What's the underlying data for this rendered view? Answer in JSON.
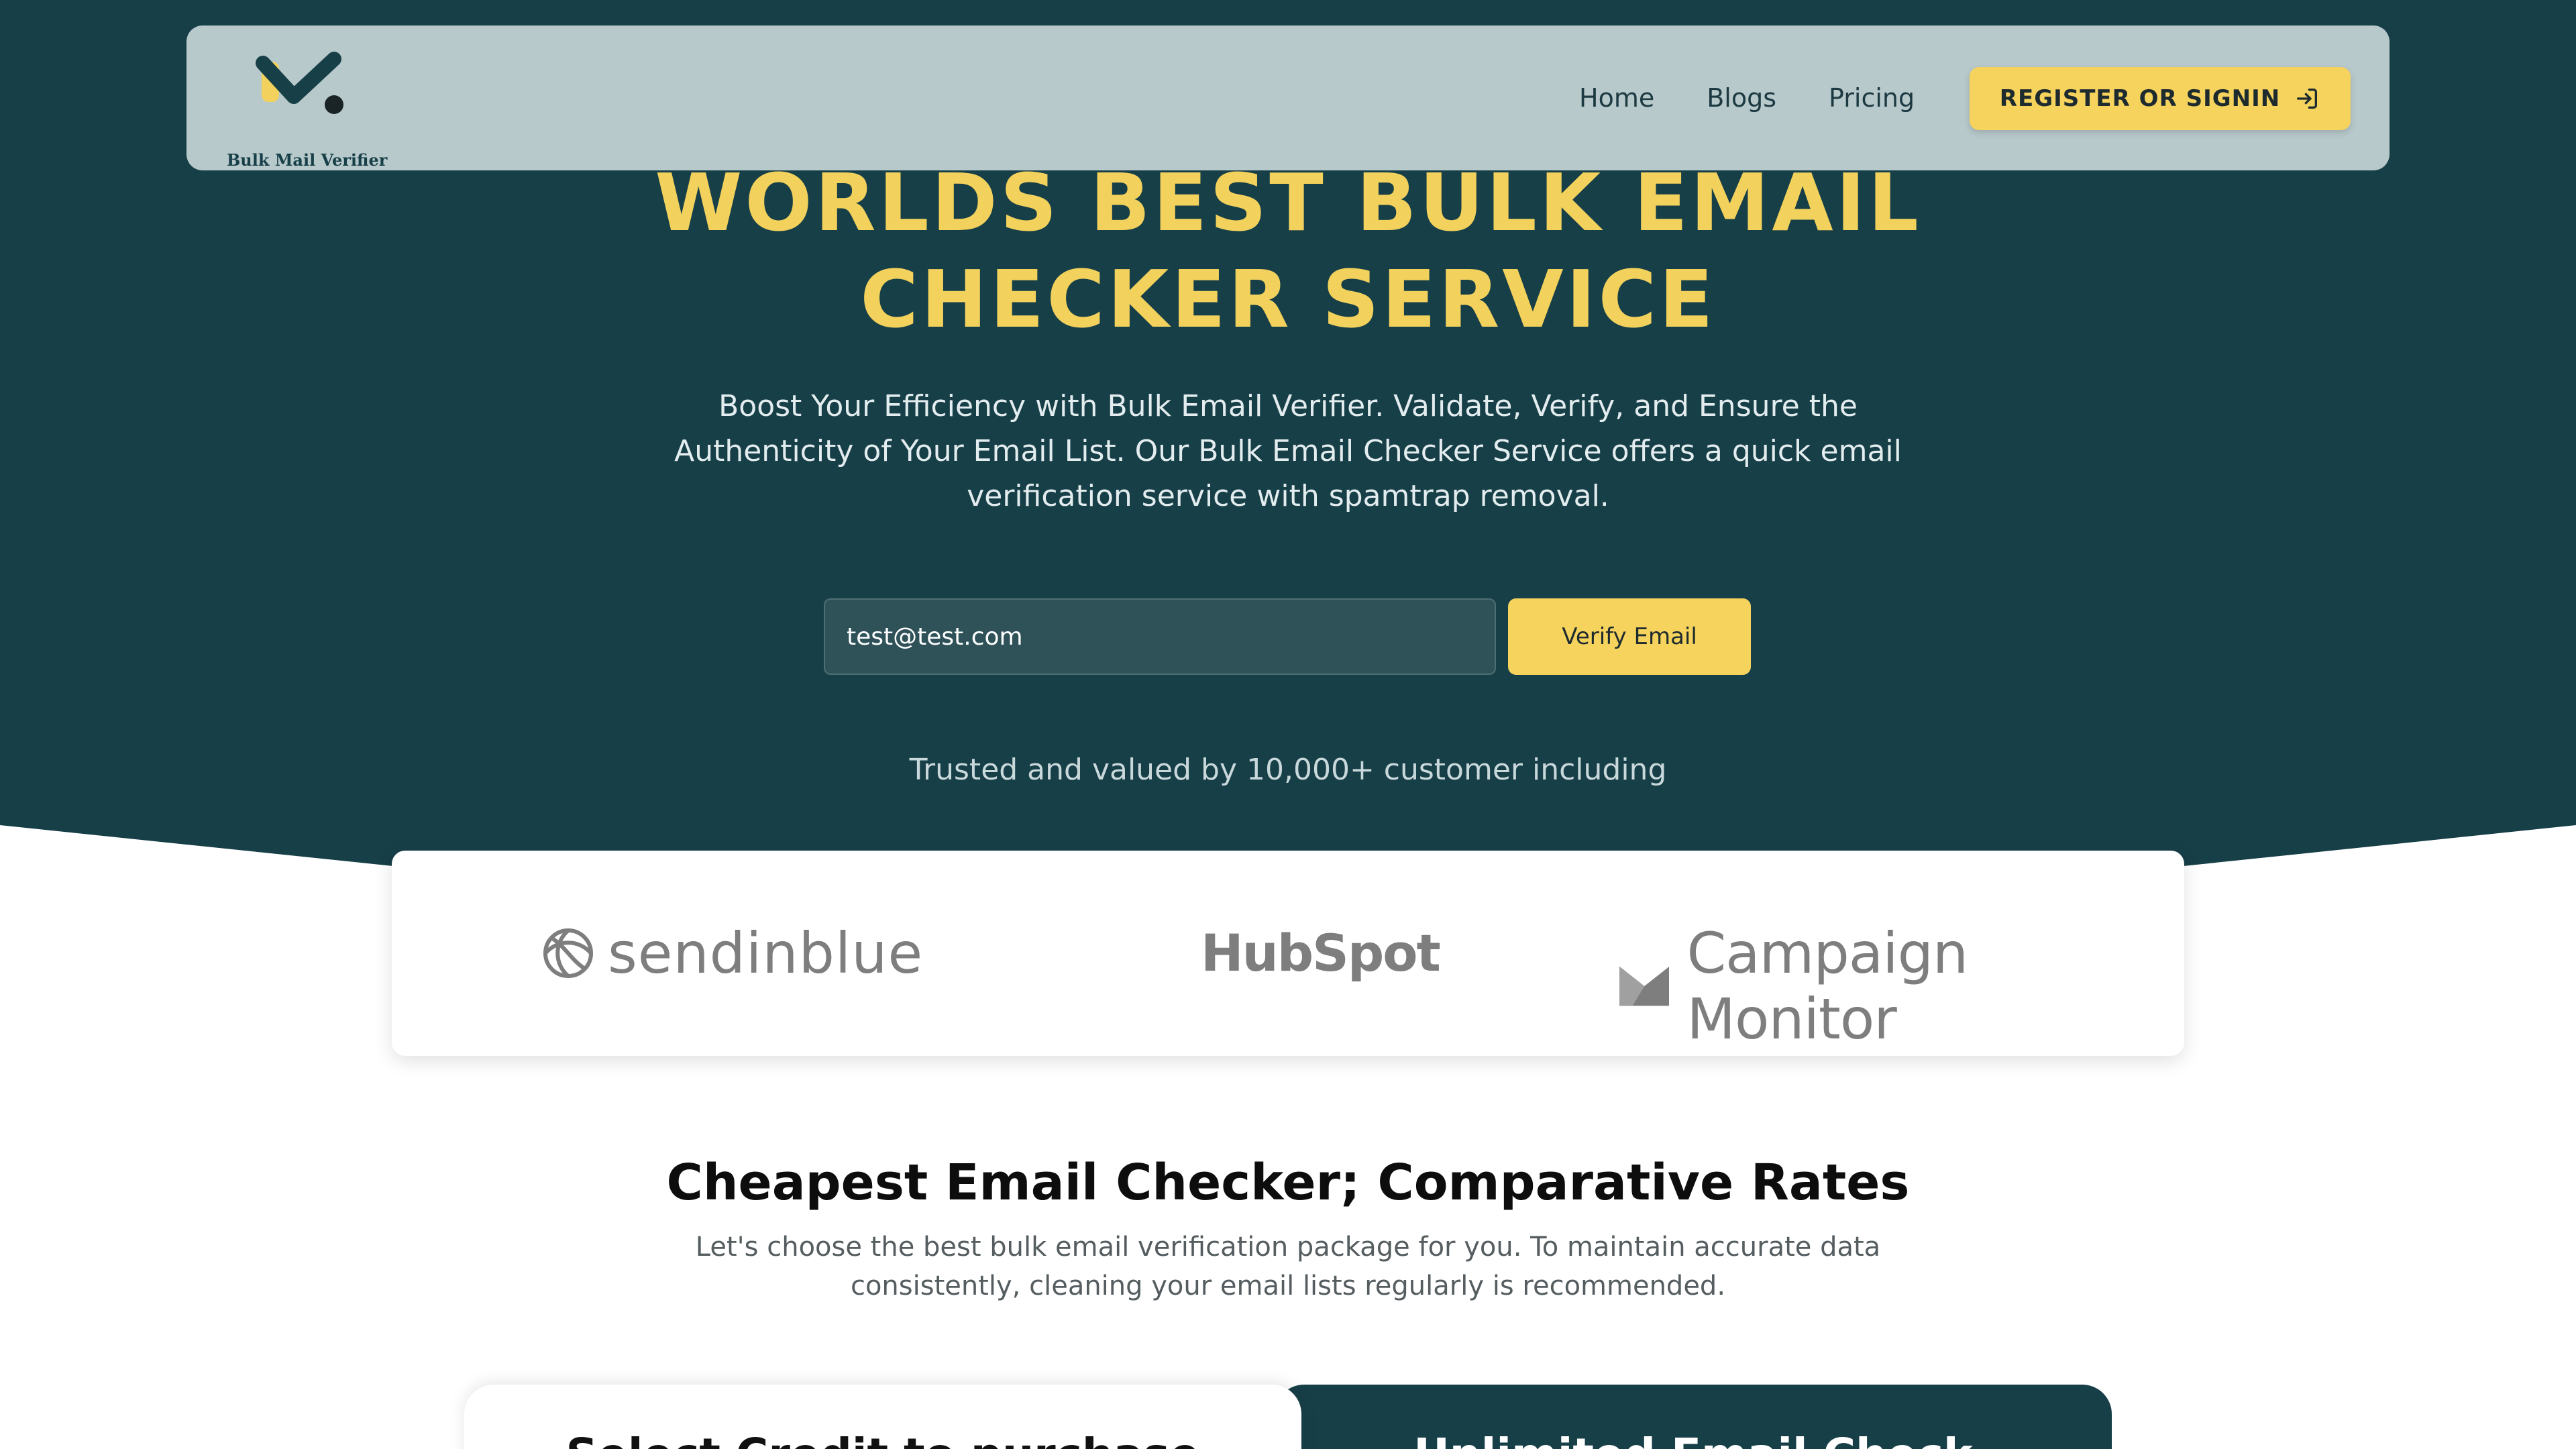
{
  "brand": {
    "logo_text": "Bulk Mail Verifier",
    "colors": {
      "primary": "#173f48",
      "accent": "#f5d35d",
      "navbar": "#b8c9cb"
    }
  },
  "nav": {
    "links": [
      "Home",
      "Blogs",
      "Pricing"
    ],
    "cta_label": "REGISTER OR SIGNIN",
    "cta_icon": "signin-arrow-icon"
  },
  "hero": {
    "title_line1": "WORLDS BEST BULK EMAIL",
    "title_line2": "CHECKER SERVICE",
    "subtitle": "Boost Your Efficiency with Bulk Email Verifier. Validate, Verify, and Ensure the Authenticity of Your Email List. Our Bulk Email Checker Service offers a quick email verification service with spamtrap removal.",
    "email_value": "test@test.com",
    "verify_label": "Verify Email",
    "trusted_text": "Trusted and valued by 10,000+ customer including"
  },
  "partners": [
    {
      "name": "sendinblue",
      "icon": "sendinblue-logo-icon"
    },
    {
      "name": "HubSpot",
      "icon": "hubspot-logo-icon"
    },
    {
      "name": "Campaign Monitor",
      "icon": "campaign-monitor-logo-icon"
    }
  ],
  "pricing": {
    "title": "Cheapest Email Checker; Comparative Rates",
    "subtitle": "Let's choose the best bulk email verification package for you. To maintain accurate data consistently, cleaning your email lists regularly is recommended.",
    "cards": [
      {
        "heading": "Select Credit to purchase"
      },
      {
        "heading": "Unlimited Email Check"
      }
    ]
  }
}
